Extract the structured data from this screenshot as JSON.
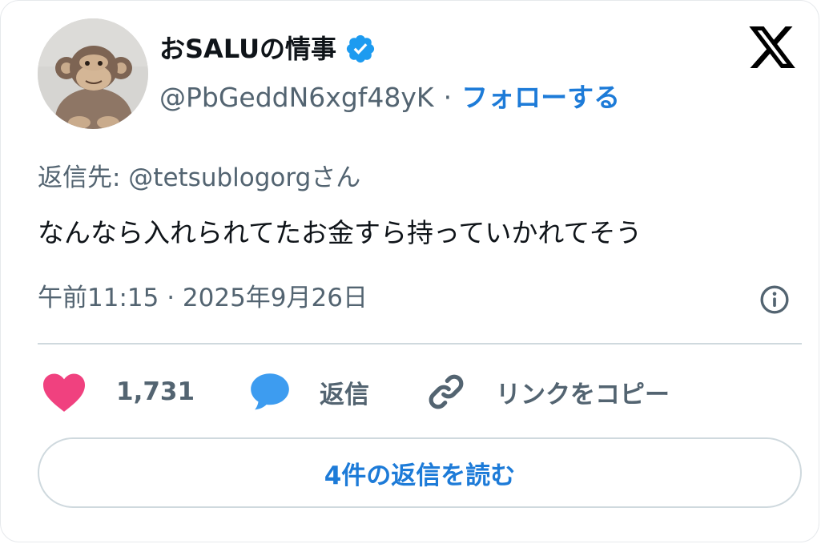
{
  "author": {
    "display_name": "おSALUの情事",
    "handle": "@PbGeddN6xgf48yK",
    "separator": "·",
    "follow_label": "フォローする",
    "verified": true
  },
  "tweet": {
    "reply_to": "返信先: @tetsublogorgさん",
    "text": "なんなら入れられてたお金すら持っていかれてそう",
    "timestamp": "午前11:15 · 2025年9月26日"
  },
  "actions": {
    "like_count": "1,731",
    "reply_label": "返信",
    "copy_link_label": "リンクをコピー"
  },
  "read_replies_label": "4件の返信を読む",
  "icons": {
    "verified": "verified-badge-icon",
    "platform": "x-logo-icon",
    "info": "info-icon",
    "like": "heart-icon",
    "reply": "speech-bubble-icon",
    "copy": "link-icon"
  },
  "colors": {
    "accent": "#1d7bd8",
    "like": "#f0417f",
    "reply_icon": "#3d9cf0",
    "secondary_text": "#536471",
    "divider": "#cfd9de"
  }
}
